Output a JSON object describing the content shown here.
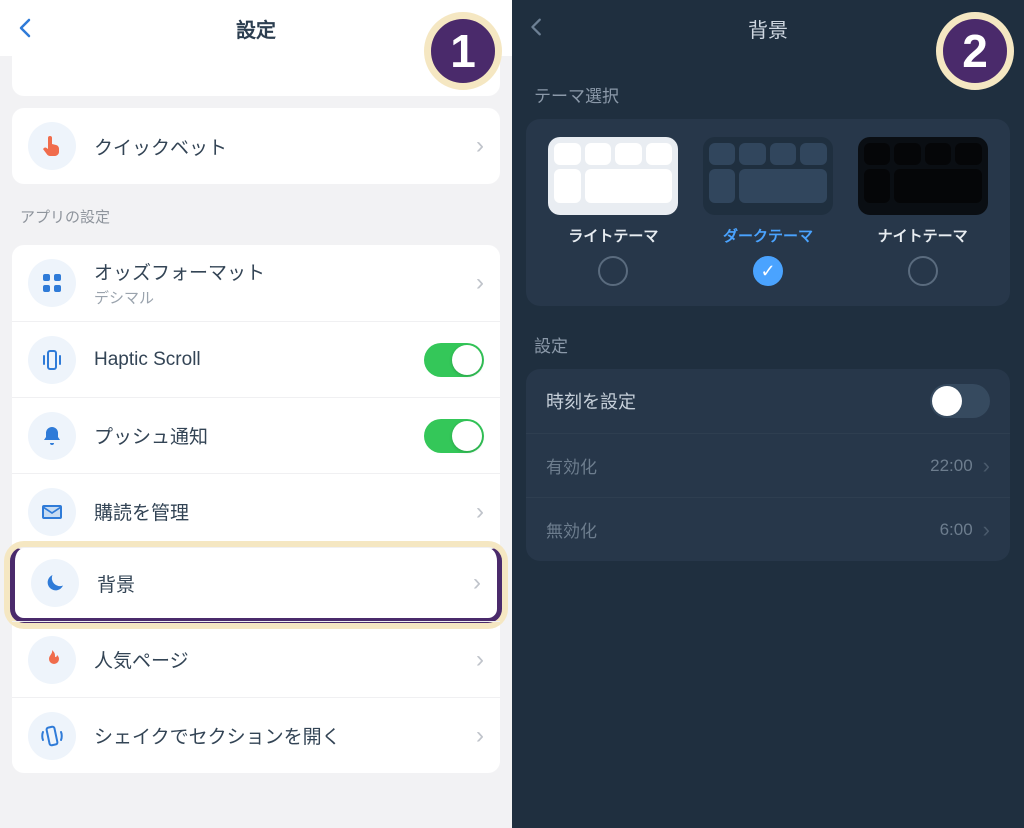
{
  "badges": {
    "left": "1",
    "right": "2"
  },
  "left": {
    "title": "設定",
    "quickbet": {
      "label": "クイックベット"
    },
    "section_app": "アプリの設定",
    "rows": {
      "odds": {
        "label": "オッズフォーマット",
        "sub": "デシマル"
      },
      "haptic": {
        "label": "Haptic Scroll"
      },
      "push": {
        "label": "プッシュ通知"
      },
      "subs": {
        "label": "購読を管理"
      },
      "bg": {
        "label": "背景"
      },
      "pop": {
        "label": "人気ページ"
      },
      "shake": {
        "label": "シェイクでセクションを開く"
      }
    }
  },
  "right": {
    "title": "背景",
    "theme_section": "テーマ選択",
    "themes": {
      "light": "ライトテーマ",
      "dark": "ダークテーマ",
      "night": "ナイトテーマ",
      "selected": "dark"
    },
    "settings_section": "設定",
    "schedule": {
      "label": "時刻を設定",
      "enable": {
        "label": "有効化",
        "time": "22:00"
      },
      "disable": {
        "label": "無効化",
        "time": "6:00"
      }
    }
  }
}
